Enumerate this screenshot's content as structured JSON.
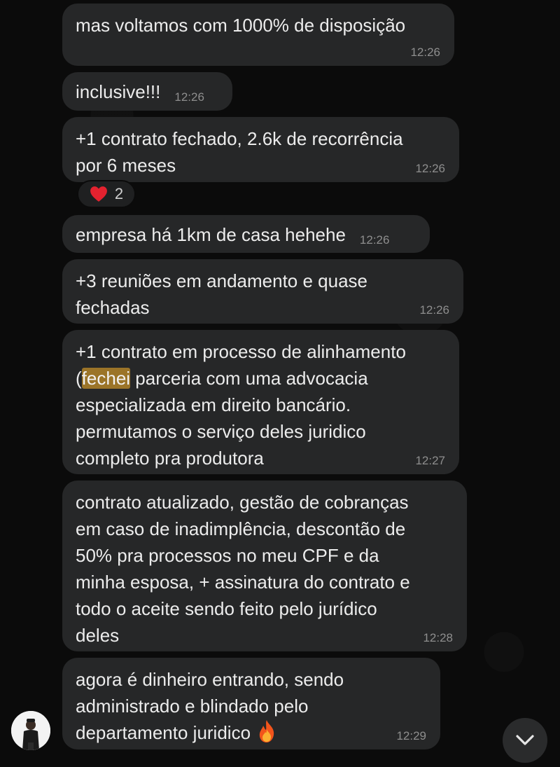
{
  "messages": [
    {
      "text": "mas voltamos com 1000% de disposição",
      "time": "12:26"
    },
    {
      "text": "inclusive!!!",
      "time": "12:26"
    },
    {
      "text": "+1 contrato fechado, 2.6k de recorrência\npor 6 meses",
      "time": "12:26"
    },
    {
      "text": "empresa há 1km de casa hehehe",
      "time": "12:26"
    },
    {
      "text": "+3 reuniões em andamento e quase\nfechadas",
      "time": "12:26"
    },
    {
      "text_before": "+1 contrato em processo de alinhamento\n(",
      "highlight": "fechei",
      "text_after": " parceria com uma advocacia\nespecializada em direito bancário.\npermutamos o serviço deles juridico\ncompleto pra produtora",
      "time": "12:27"
    },
    {
      "text": "contrato atualizado, gestão de cobranças\nem caso de inadimplência, descontão de\n50% pra processos no meu CPF e da\nminha esposa, + assinatura do contrato e\ntodo o aceite sendo feito pelo jurídico\ndeles",
      "time": "12:28"
    },
    {
      "text": "agora é dinheiro entrando, sendo\nadministrado e blindado pelo\ndepartamento juridico",
      "emoji": "fire-icon",
      "time": "12:29"
    }
  ],
  "reaction": {
    "emoji": "heart-icon",
    "count": "2"
  },
  "icons": {
    "scroll": "chevron-down-icon",
    "avatar": "user-avatar"
  },
  "colors": {
    "bubble": "#262728",
    "highlight": "#9b7428",
    "background": "#0b0b0b",
    "time": "#8e8e8e"
  }
}
